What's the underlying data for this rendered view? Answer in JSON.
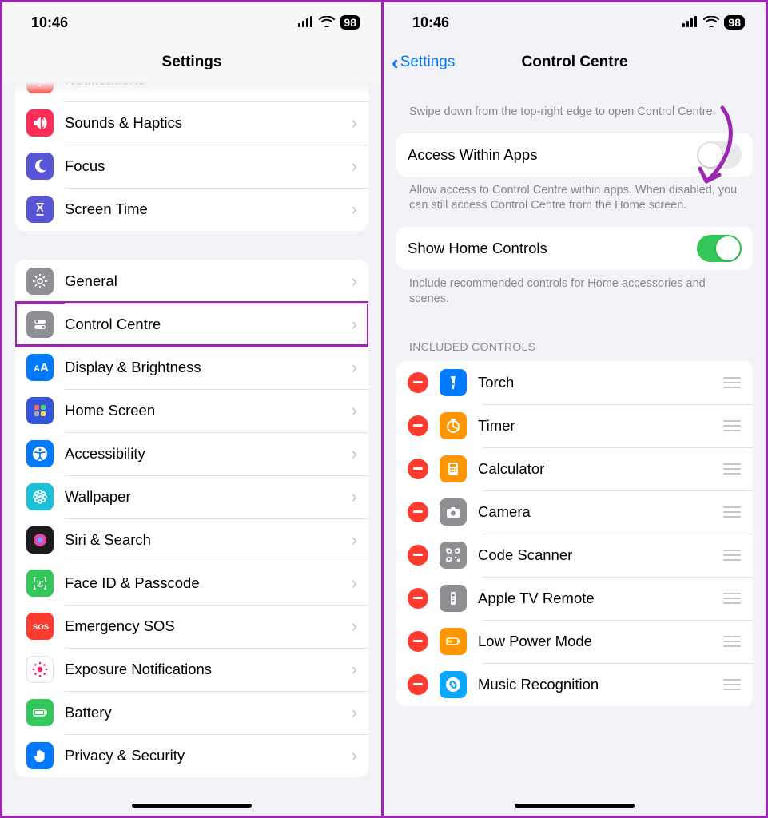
{
  "status": {
    "time": "10:46",
    "battery": "98"
  },
  "left": {
    "title": "Settings",
    "rows": [
      {
        "label": "Notifications",
        "iconColor": "#ff3b30",
        "iconName": "bell-icon"
      },
      {
        "label": "Sounds & Haptics",
        "iconColor": "#ff2d55",
        "iconName": "speaker-icon"
      },
      {
        "label": "Focus",
        "iconColor": "#5856d6",
        "iconName": "moon-icon"
      },
      {
        "label": "Screen Time",
        "iconColor": "#5856d6",
        "iconName": "hourglass-icon"
      }
    ],
    "rows2": [
      {
        "label": "General",
        "iconColor": "#8e8e93",
        "iconName": "gear-icon"
      },
      {
        "label": "Control Centre",
        "iconColor": "#8e8e93",
        "iconName": "toggles-icon",
        "highlight": true
      },
      {
        "label": "Display & Brightness",
        "iconColor": "#007aff",
        "iconName": "text-size-icon"
      },
      {
        "label": "Home Screen",
        "iconColor": "#3355dd",
        "iconName": "grid-icon"
      },
      {
        "label": "Accessibility",
        "iconColor": "#007aff",
        "iconName": "accessibility-icon"
      },
      {
        "label": "Wallpaper",
        "iconColor": "#19c2d8",
        "iconName": "flower-icon"
      },
      {
        "label": "Siri & Search",
        "iconColor": "#1b1b1d",
        "iconName": "siri-icon"
      },
      {
        "label": "Face ID & Passcode",
        "iconColor": "#34c759",
        "iconName": "faceid-icon"
      },
      {
        "label": "Emergency SOS",
        "iconColor": "#ff3b30",
        "iconName": "sos-icon"
      },
      {
        "label": "Exposure Notifications",
        "iconColor": "#ffffff",
        "iconName": "exposure-icon"
      },
      {
        "label": "Battery",
        "iconColor": "#34c759",
        "iconName": "battery-icon"
      },
      {
        "label": "Privacy & Security",
        "iconColor": "#007aff",
        "iconName": "hand-icon"
      }
    ]
  },
  "right": {
    "back": "Settings",
    "title": "Control Centre",
    "intro": "Swipe down from the top-right edge to open Control Centre.",
    "toggle1": {
      "label": "Access Within Apps",
      "on": false
    },
    "toggle1_footer": "Allow access to Control Centre within apps. When disabled, you can still access Control Centre from the Home screen.",
    "toggle2": {
      "label": "Show Home Controls",
      "on": true
    },
    "toggle2_footer": "Include recommended controls for Home accessories and scenes.",
    "included_header": "Included Controls",
    "controls": [
      {
        "label": "Torch",
        "iconColor": "#007aff",
        "iconName": "torch-icon"
      },
      {
        "label": "Timer",
        "iconColor": "#ff9500",
        "iconName": "timer-icon"
      },
      {
        "label": "Calculator",
        "iconColor": "#ff9500",
        "iconName": "calculator-icon"
      },
      {
        "label": "Camera",
        "iconColor": "#8e8e93",
        "iconName": "camera-icon"
      },
      {
        "label": "Code Scanner",
        "iconColor": "#8e8e93",
        "iconName": "qr-icon"
      },
      {
        "label": "Apple TV Remote",
        "iconColor": "#8e8e93",
        "iconName": "remote-icon"
      },
      {
        "label": "Low Power Mode",
        "iconColor": "#ff9500",
        "iconName": "lowpower-icon"
      },
      {
        "label": "Music Recognition",
        "iconColor": "#0aa7ff",
        "iconName": "shazam-icon"
      }
    ]
  }
}
